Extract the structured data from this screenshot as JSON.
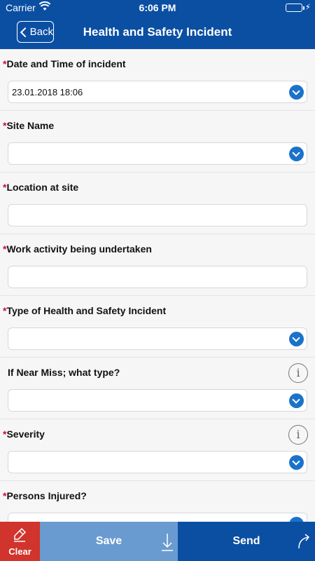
{
  "status_bar": {
    "carrier": "Carrier",
    "time": "6:06 PM"
  },
  "nav": {
    "back_label": "Back",
    "title": "Health and Safety Incident"
  },
  "form": {
    "fields": [
      {
        "label": "Date and Time of incident",
        "required": true,
        "type": "dropdown",
        "value": "23.01.2018 18:06"
      },
      {
        "label": "Site Name",
        "required": true,
        "type": "dropdown",
        "value": ""
      },
      {
        "label": "Location at site",
        "required": true,
        "type": "text",
        "value": ""
      },
      {
        "label": "Work activity being undertaken",
        "required": true,
        "type": "text",
        "value": ""
      },
      {
        "label": "Type of Health and Safety Incident",
        "required": true,
        "type": "dropdown",
        "value": ""
      },
      {
        "label": "If Near Miss; what type?",
        "required": false,
        "type": "dropdown",
        "value": "",
        "info": true
      },
      {
        "label": "Severity",
        "required": true,
        "type": "dropdown",
        "value": "",
        "info": true
      },
      {
        "label": "Persons Injured?",
        "required": true,
        "type": "dropdown",
        "value": ""
      }
    ],
    "required_marker": "*",
    "info_glyph": "i"
  },
  "toolbar": {
    "clear_label": "Clear",
    "save_label": "Save",
    "send_label": "Send"
  },
  "colors": {
    "brand_blue": "#0b4fa3",
    "clear_red": "#d0342c",
    "save_blue": "#6a9bd0",
    "dropdown_blue": "#1a73c9",
    "required_red": "#c8102e",
    "battery_green": "#4cd964"
  }
}
